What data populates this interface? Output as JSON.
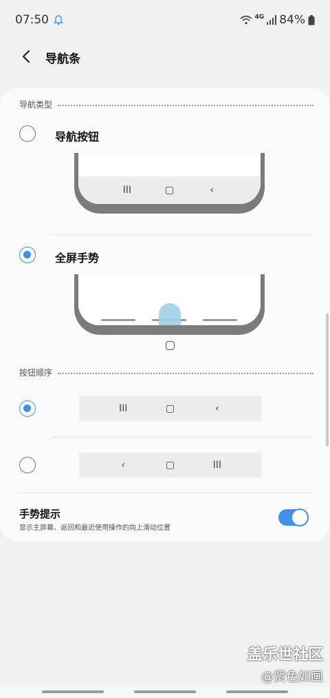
{
  "status": {
    "time": "07:50",
    "network": "4G",
    "battery": "84%"
  },
  "header": {
    "title": "导航条"
  },
  "nav_type": {
    "section_title": "导航类型",
    "options": [
      {
        "label": "导航按钮",
        "selected": false
      },
      {
        "label": "全屏手势",
        "selected": true
      }
    ]
  },
  "button_order": {
    "section_title": "按钮顺序",
    "options": [
      {
        "glyphs": [
          "III",
          "▢",
          "‹"
        ],
        "selected": true
      },
      {
        "glyphs": [
          "‹",
          "▢",
          "III"
        ],
        "selected": false
      }
    ]
  },
  "gesture_hint": {
    "title": "手势提示",
    "subtitle": "显示主屏幕、返回和最近使用操作的向上滑动位置",
    "enabled": true
  },
  "watermark": {
    "line1": "盖乐世社区",
    "line2": "@贤色如画"
  },
  "colors": {
    "accent": "#3e91e8",
    "touch": "#9fd1e6"
  },
  "icons": [
    "notification-bell-icon",
    "wifi-icon",
    "signal-icon",
    "battery-icon",
    "back-arrow-icon"
  ]
}
